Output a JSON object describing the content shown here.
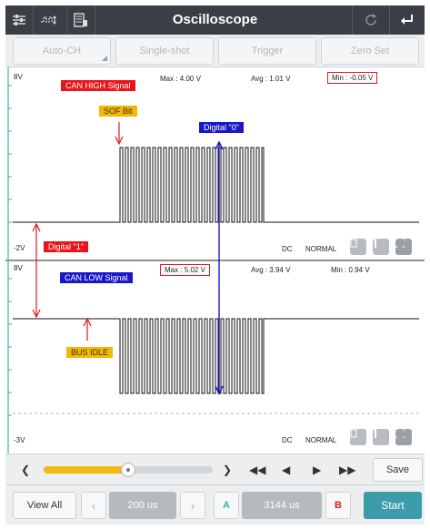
{
  "app": {
    "title": "Oscilloscope"
  },
  "toolbar": {
    "icons": [
      "settings-sliders-icon",
      "waveform-icon",
      "save-file-icon",
      "refresh-icon",
      "back-icon"
    ]
  },
  "modes": [
    {
      "label": "Auto-CH"
    },
    {
      "label": "Single-shot"
    },
    {
      "label": "Trigger"
    },
    {
      "label": "Zero Set"
    }
  ],
  "channel1": {
    "top_scale": "8V",
    "bottom_scale": "-2V",
    "max": "Max : 4.00 V",
    "avg": "Avg : 1.01 V",
    "min": "Min : -0.05 V",
    "coupling": "DC",
    "mode": "NORMAL"
  },
  "channel2": {
    "top_scale": "8V",
    "bottom_scale": "-3V",
    "max": "Max : 5.02 V",
    "avg": "Avg : 3.94 V",
    "min": "Min : 0.94 V",
    "coupling": "DC",
    "mode": "NORMAL"
  },
  "annotations": {
    "can_high": "CAN HIGH Signal",
    "can_low": "CAN LOW Signal",
    "sof_bit": "SOF Bit",
    "digital_zero": "Digital \"0\"",
    "digital_one": "Digital \"1\"",
    "bus_idle": "BUS IDLE"
  },
  "colors": {
    "accent_red": "#e8151b",
    "accent_blue": "#1a17c8",
    "accent_orange": "#f5b800",
    "start_teal": "#3c9ca9",
    "slider_yellow": "#f2b90f"
  },
  "playback": {
    "slider_position": 0.5,
    "save_label": "Save"
  },
  "bottom": {
    "view_all": "View All",
    "time_div": "200 us",
    "marker_a": "A",
    "marker_value": "3144 us",
    "marker_b": "B",
    "start": "Start"
  }
}
